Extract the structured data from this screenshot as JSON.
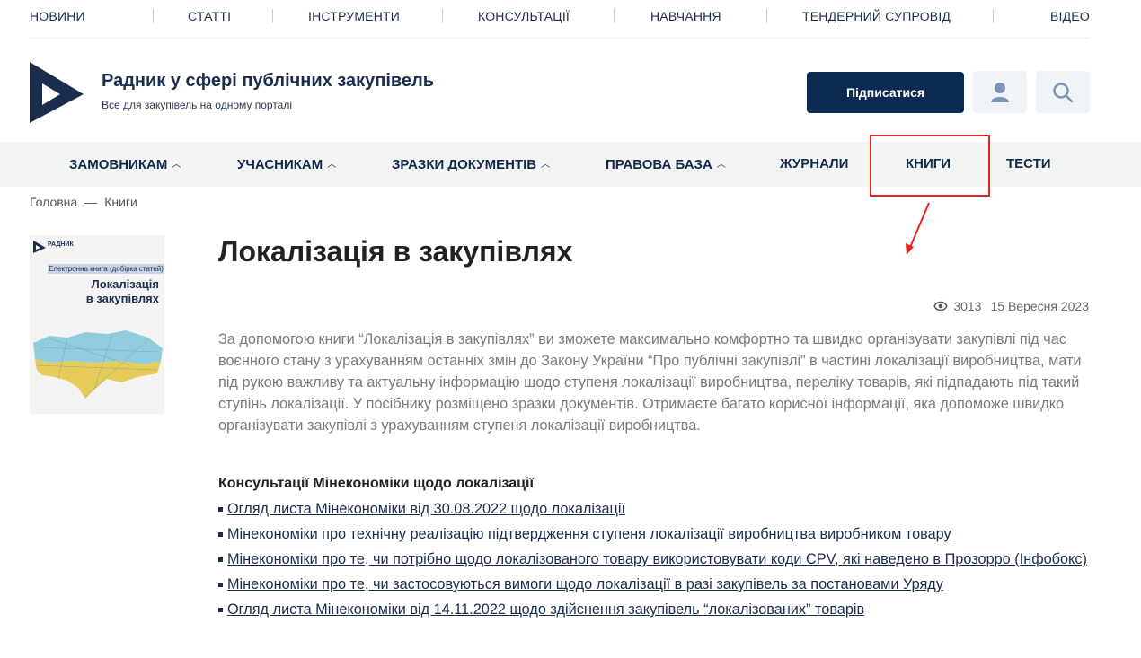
{
  "top_nav": [
    "НОВИНИ",
    "СТАТТІ",
    "ІНСТРУМЕНТИ",
    "КОНСУЛЬТАЦІЇ",
    "НАВЧАННЯ",
    "ТЕНДЕРНИЙ СУПРОВІД",
    "ВІДЕО"
  ],
  "header": {
    "title": "Радник у сфері публічних закупівель",
    "subtitle": "Все для закупівель на одному порталі",
    "subscribe_label": "Підписатися"
  },
  "main_nav": [
    {
      "label": "ЗАМОВНИКАМ",
      "dropdown": true
    },
    {
      "label": "УЧАСНИКАМ",
      "dropdown": true
    },
    {
      "label": "ЗРАЗКИ ДОКУМЕНТІВ",
      "dropdown": true
    },
    {
      "label": "ПРАВОВА БАЗА",
      "dropdown": true
    },
    {
      "label": "ЖУРНАЛИ",
      "dropdown": false
    },
    {
      "label": "КНИГИ",
      "dropdown": false,
      "highlighted": true
    },
    {
      "label": "ТЕСТИ",
      "dropdown": false
    }
  ],
  "breadcrumb": {
    "home": "Головна",
    "separator": "—",
    "current": "Книги"
  },
  "book_cover": {
    "brand": "РАДНИК",
    "ribbon": "Електронна книга (добірка статей)",
    "title_line1": "Локалізація",
    "title_line2": "в закупівлях"
  },
  "article": {
    "title": "Локалізація в закупівлях",
    "views": "3013",
    "date": "15 Вересня 2023",
    "description": "За допомогою книги “Локалізація в закупівлях” ви зможете максимально комфортно та швидко організувати закупівлі під час воєнного стану з урахуванням останніх змін до Закону України “Про публічні закупівлі” в частині локалізації виробництва, мати під рукою важливу та актуальну інформацію щодо ступеня локалізації виробництва, переліку товарів, які підпадають під такий ступінь локалізації. У посібнику розміщено зразки документів. Отримаєте багато корисної інформації, яка допоможе швидко організувати закупівлі з урахуванням ступеня локалізації виробництва.",
    "section_title": "Консультації Мінекономіки щодо локалізації",
    "links": [
      "Огляд листа Мінекономіки від 30.08.2022 щодо локалізації",
      "Мінекономіки про технічну реалізацію підтвердження ступеня локалізації виробництва виробником товару",
      "Мінекономіки про те, чи потрібно щодо локалізованого товару використовувати коди CPV, які наведено в Прозорро (Інфобокс)",
      "Мінекономіки про те, чи застосовуються вимоги щодо локалізації в разі закупівель за постановами Уряду",
      "Огляд листа Мінекономіки від 14.11.2022 щодо здійснення закупівель “локалізованих” товарів"
    ]
  },
  "colors": {
    "brand": "#1a2d4d",
    "button": "#0d2b52",
    "highlight": "#e32424"
  }
}
